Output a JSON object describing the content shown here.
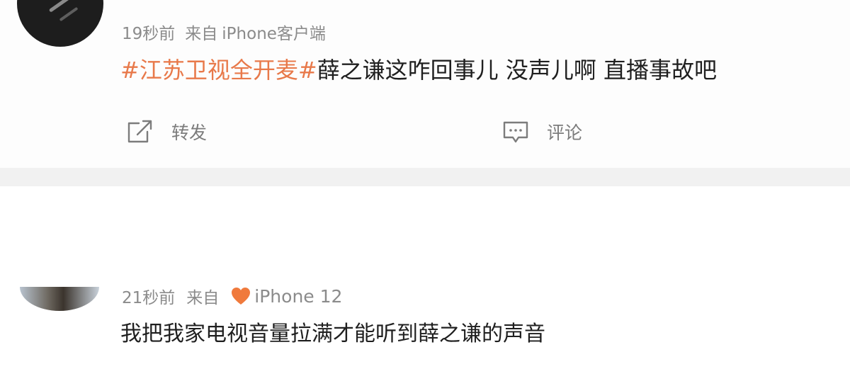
{
  "posts": [
    {
      "time": "19秒前",
      "source_prefix": "来自",
      "source": "iPhone客户端",
      "hashtag": "#江苏卫视全开麦#",
      "text": "薛之谦这咋回事儿 没声儿啊 直播事故吧",
      "actions": {
        "repost_label": "转发",
        "comment_label": "评论"
      }
    },
    {
      "time": "21秒前",
      "source_prefix": "来自",
      "source": "iPhone 12",
      "text": "我把我家电视音量拉满才能听到薛之谦的声音"
    }
  ],
  "colors": {
    "hashtag": "#e8794a",
    "meta": "#8b8b8b",
    "heart": "#f07a3c"
  }
}
